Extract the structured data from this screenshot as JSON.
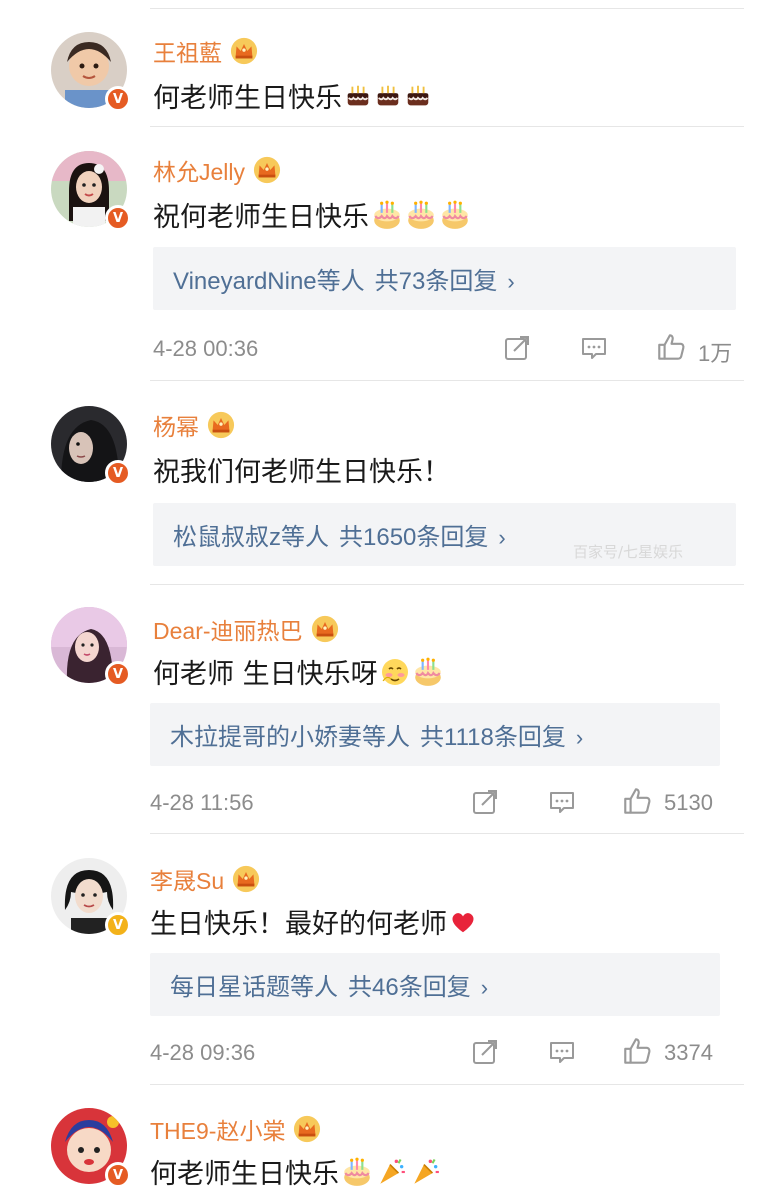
{
  "comments": [
    {
      "name": "王祖藍",
      "text": "何老师生日快乐",
      "emojis": [
        "cake-icon",
        "cake-icon",
        "cake-icon"
      ],
      "badge": "V",
      "badge_color": "#e55b23"
    },
    {
      "name": "林允Jelly",
      "text": "祝何老师生日快乐",
      "emojis": [
        "birthday-cake-icon",
        "birthday-cake-icon",
        "birthday-cake-icon"
      ],
      "badge": "V",
      "badge_color": "#e55b23",
      "reply_names": "VineyardNine等人",
      "reply_count": "共73条回复",
      "time": "4-28 00:36",
      "likes": "1万"
    },
    {
      "name": "杨幂",
      "text": "祝我们何老师生日快乐！",
      "badge": "V",
      "badge_color": "#e55b23",
      "reply_names": "松鼠叔叔z等人",
      "reply_count": "共1650条回复",
      "watermark": "百家号/七星娱乐"
    },
    {
      "name": "Dear-迪丽热巴",
      "text": "何老师 生日快乐呀",
      "emojis": [
        "shy-face-icon",
        "birthday-cake-icon"
      ],
      "badge": "V",
      "badge_color": "#e55b23",
      "reply_names": "木拉提哥的小娇妻等人",
      "reply_count": "共1118条回复",
      "time": "4-28 11:56",
      "likes": "5130"
    },
    {
      "name": "李晟Su",
      "text": "生日快乐！最好的何老师",
      "emojis": [
        "red-heart-icon"
      ],
      "badge": "V",
      "badge_color": "#f3b21a",
      "reply_names": "每日星话题等人",
      "reply_count": "共46条回复",
      "time": "4-28 09:36",
      "likes": "3374"
    },
    {
      "name": "THE9-赵小棠",
      "text": "何老师生日快乐",
      "emojis": [
        "birthday-cake-icon",
        "party-popper-icon",
        "party-popper-icon"
      ],
      "badge": "V",
      "badge_color": "#e55b23"
    }
  ],
  "chevron": "›",
  "colors": {
    "name": "#e8803c",
    "reply_link": "#4f6f95",
    "meta": "#8c8c8c",
    "reply_bg": "#f3f4f6"
  }
}
